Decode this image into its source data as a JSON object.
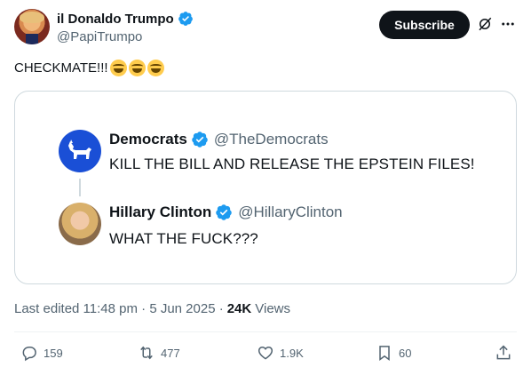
{
  "author": {
    "display_name": "il Donaldo Trumpo",
    "handle": "@PapiTrumpo"
  },
  "header": {
    "subscribe_label": "Subscribe"
  },
  "tweet": {
    "text": "CHECKMATE!!!",
    "emojis": [
      "laughing-tears",
      "laughing-tears",
      "laughing-tears"
    ]
  },
  "quote": {
    "post1": {
      "name": "Democrats",
      "handle": "@TheDemocrats",
      "text": "KILL THE BILL AND RELEASE THE EPSTEIN FILES!"
    },
    "post2": {
      "name": "Hillary Clinton",
      "handle": "@HillaryClinton",
      "text": "WHAT THE FUCK???"
    }
  },
  "meta": {
    "edited": "Last edited 11:48 pm · 5 Jun 2025 ·",
    "views_count": "24K",
    "views_label": "Views"
  },
  "actions": {
    "replies": "159",
    "reposts": "477",
    "likes": "1.9K",
    "bookmarks": "60"
  },
  "colors": {
    "verified_blue": "#1d9bf0",
    "secondary_text": "#536471",
    "border": "#cfd9de",
    "democrats_blue": "#1a4fd6"
  }
}
